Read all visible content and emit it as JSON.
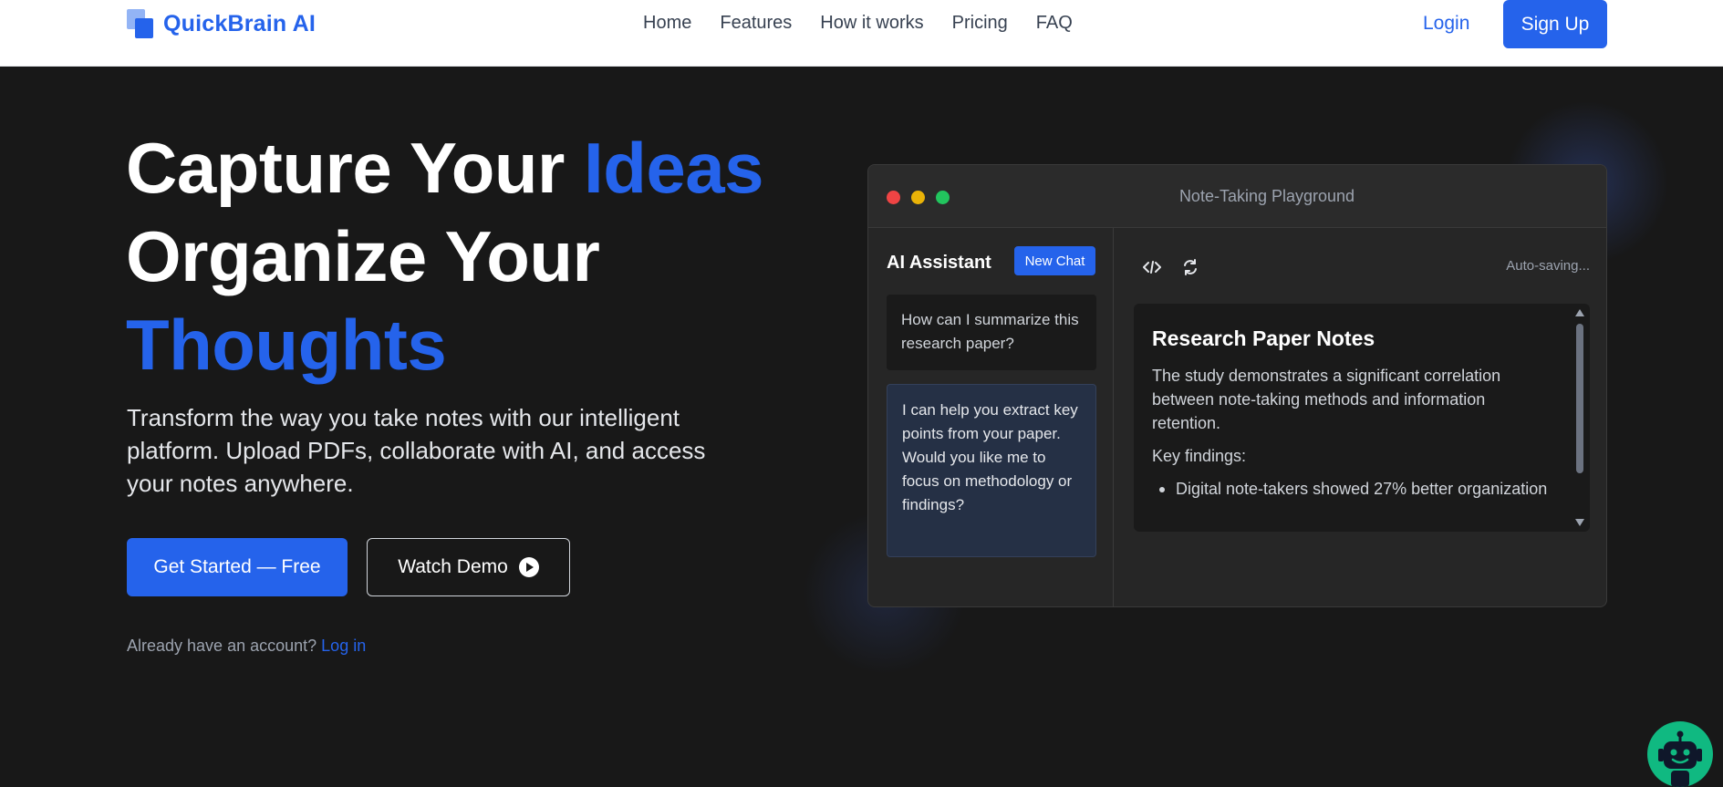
{
  "nav": {
    "brand": "QuickBrain AI",
    "links": [
      "Home",
      "Features",
      "How it works",
      "Pricing",
      "FAQ"
    ],
    "login": "Login",
    "signup": "Sign Up"
  },
  "hero": {
    "line1_plain": "Capture Your ",
    "line1_accent": "Ideas",
    "line2": "Organize Your",
    "line3_accent": "Thoughts",
    "description": "Transform the way you take notes with our intelligent platform. Upload PDFs, collaborate with AI, and access your notes anywhere.",
    "primary_cta": "Get Started — Free",
    "secondary_cta": "Watch Demo",
    "account_prompt": "Already have an account?",
    "account_link": "Log in"
  },
  "playground": {
    "title": "Note-Taking Playground",
    "chat_heading": "AI Assistant",
    "new_chat": "New Chat",
    "user_message": "How can I summarize this research paper?",
    "ai_message": "I can help you extract key points from your paper. Would you like me to focus on methodology or findings?",
    "autosave": "Auto-saving...",
    "note": {
      "title": "Research Paper Notes",
      "paragraph": "The study demonstrates a significant correlation between note-taking methods and information retention.",
      "findings_label": "Key findings:",
      "findings": [
        "Digital note-takers showed 27% better organization"
      ]
    }
  },
  "colors": {
    "accent": "#2563eb",
    "background": "#181818",
    "bot": "#10b981"
  }
}
